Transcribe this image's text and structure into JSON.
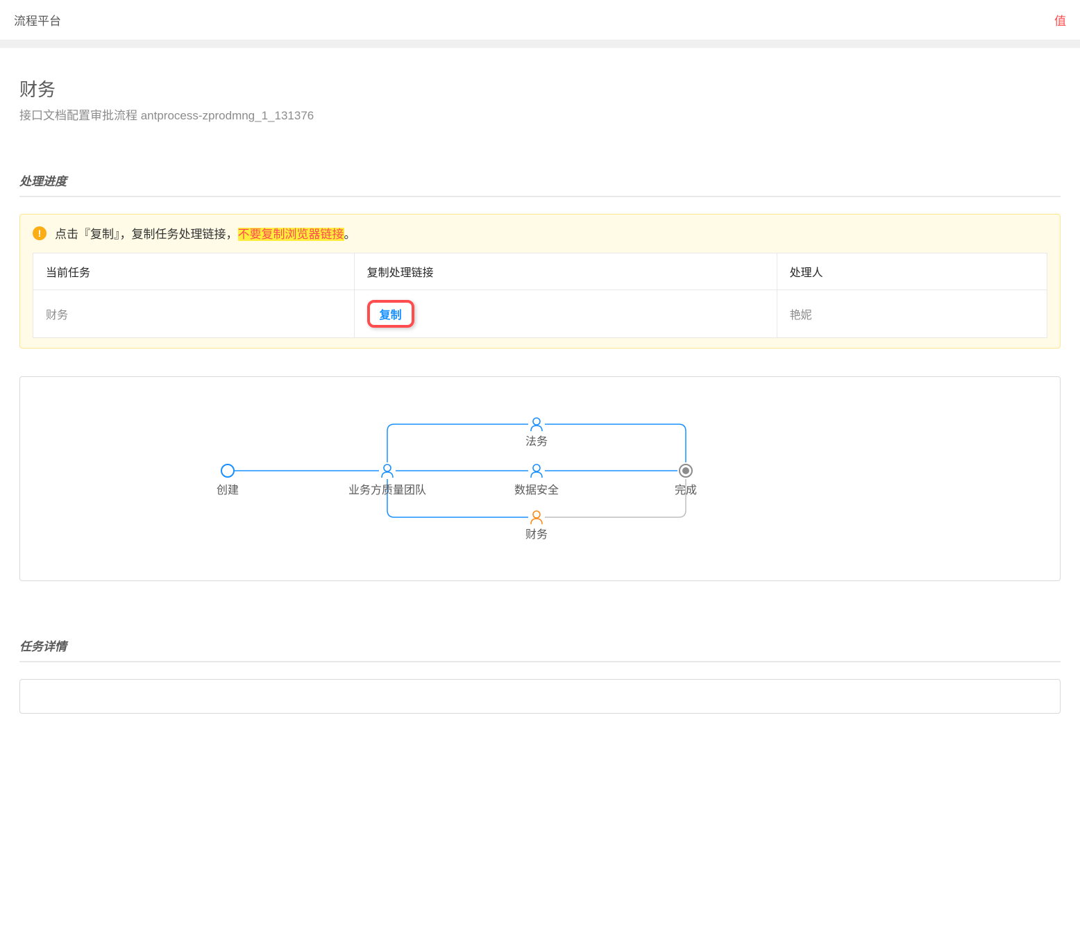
{
  "topbar": {
    "title": "流程平台",
    "right_partial": "值"
  },
  "header": {
    "title": "财务",
    "subtitle": "接口文档配置审批流程  antprocess-zprodmng_1_131376"
  },
  "sections": {
    "progress": "处理进度",
    "detail": "任务详情"
  },
  "alert": {
    "pre": "点击『复制』，复制任务处理链接，",
    "highlight": "不要复制浏览器链接",
    "post": "。"
  },
  "table": {
    "headers": {
      "current_task": "当前任务",
      "copy_link": "复制处理链接",
      "handler": "处理人"
    },
    "row": {
      "task": "财务",
      "copy": "复制",
      "handler": "艳妮"
    }
  },
  "flow": {
    "nodes": {
      "create": "创建",
      "quality_team": "业务方质量团队",
      "legal": "法务",
      "data_security": "数据安全",
      "finance": "财务",
      "done": "完成"
    }
  }
}
